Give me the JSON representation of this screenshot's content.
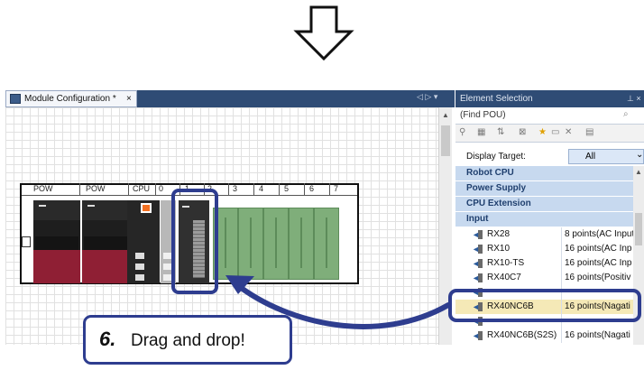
{
  "module_config": {
    "tab_title": "Module Configuration *",
    "close_glyph": "×",
    "tab_nav": "◁ ▷ ▾",
    "slot_labels": [
      "POW",
      "POW",
      "CPU",
      "0",
      "1",
      "2",
      "3",
      "4",
      "5",
      "6",
      "7"
    ]
  },
  "element_selection": {
    "title": "Element Selection",
    "pin": "⊥ ×",
    "search_placeholder": "(Find POU)",
    "display_target_label": "Display Target:",
    "display_target_value": "All",
    "categories": [
      "Robot CPU",
      "Power Supply",
      "CPU Extension",
      "Input"
    ],
    "items": [
      {
        "name": "RX28",
        "desc": "8 points(AC Input"
      },
      {
        "name": "RX10",
        "desc": "16 points(AC Inp"
      },
      {
        "name": "RX10-TS",
        "desc": "16 points(AC Inp"
      },
      {
        "name": "RX40C7",
        "desc": "16 points(Positiv"
      },
      {
        "name": "RX40NC6B",
        "desc": "16 points(Nagati"
      },
      {
        "name": "RX40NC6B(S2S)",
        "desc": "16 points(Nagati"
      }
    ],
    "selected_item": "RX40NC6B"
  },
  "callout": {
    "step": "6.",
    "text": "Drag and drop!"
  },
  "colors": {
    "highlight": "#2e3d8f",
    "header_bg": "#2f4c75",
    "category_bg": "#c7d9ef",
    "selected_row": "#f5e9b7",
    "power_red": "#8f1f34",
    "empty_slot_green": "#7fae7a",
    "cpu_orange": "#f37021"
  }
}
